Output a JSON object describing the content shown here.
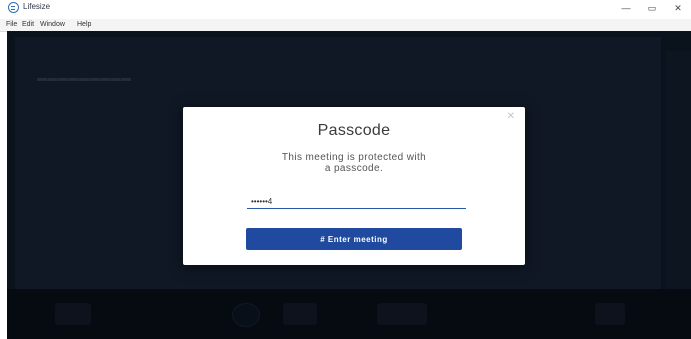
{
  "window": {
    "title": "Lifesize",
    "controls": {
      "minimize": "—",
      "maximize": "▭",
      "close": "✕"
    }
  },
  "menu": {
    "items": [
      "File",
      "Edit",
      "Window",
      "Help"
    ]
  },
  "dialog": {
    "title": "Passcode",
    "description": "This meeting is protected with a passcode.",
    "passcode_value": "••••••4",
    "button_label": "# Enter meeting",
    "close_glyph": "✕"
  },
  "colors": {
    "accent": "#1f4aa0",
    "app_background": "#0d1623"
  }
}
